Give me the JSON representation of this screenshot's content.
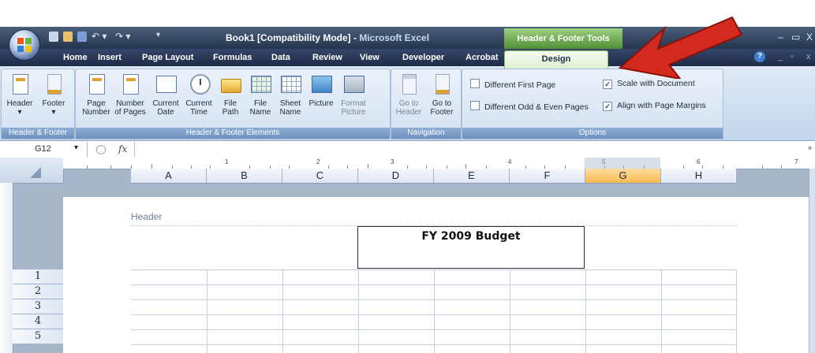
{
  "window": {
    "title_main": "Book1  [Compatibility Mode] - ",
    "title_app": "Microsoft Excel",
    "contextual_title": "Header & Footer Tools"
  },
  "tabs": [
    "Home",
    "Insert",
    "Page Layout",
    "Formulas",
    "Data",
    "Review",
    "View",
    "Developer",
    "Acrobat"
  ],
  "active_tab": "Design",
  "ribbon": {
    "groups": {
      "header_footer": {
        "label": "Header & Footer",
        "buttons": [
          {
            "line1": "Header",
            "line2": "▾"
          },
          {
            "line1": "Footer",
            "line2": "▾"
          }
        ]
      },
      "elements": {
        "label": "Header & Footer Elements",
        "buttons": [
          {
            "line1": "Page",
            "line2": "Number"
          },
          {
            "line1": "Number",
            "line2": "of Pages"
          },
          {
            "line1": "Current",
            "line2": "Date"
          },
          {
            "line1": "Current",
            "line2": "Time"
          },
          {
            "line1": "File",
            "line2": "Path"
          },
          {
            "line1": "File",
            "line2": "Name"
          },
          {
            "line1": "Sheet",
            "line2": "Name"
          },
          {
            "line1": "Picture",
            "line2": ""
          },
          {
            "line1": "Format",
            "line2": "Picture"
          }
        ]
      },
      "navigation": {
        "label": "Navigation",
        "buttons": [
          {
            "line1": "Go to",
            "line2": "Header"
          },
          {
            "line1": "Go to",
            "line2": "Footer"
          }
        ]
      },
      "options": {
        "label": "Options",
        "checks": [
          {
            "text": "Different First Page",
            "checked": false
          },
          {
            "text": "Different Odd & Even Pages",
            "checked": false
          },
          {
            "text": "Scale with Document",
            "checked": true
          },
          {
            "text": "Align with Page Margins",
            "checked": true
          }
        ]
      }
    }
  },
  "formula_bar": {
    "name_box": "G12",
    "fx": "fx",
    "value": ""
  },
  "ruler_numbers": [
    "1",
    "2",
    "3",
    "4",
    "5",
    "6",
    "7"
  ],
  "columns": [
    "A",
    "B",
    "C",
    "D",
    "E",
    "F",
    "G",
    "H"
  ],
  "selected_column": "G",
  "rows": [
    "1",
    "2",
    "3",
    "4",
    "5"
  ],
  "page": {
    "header_label": "Header",
    "center_header": "FY 2009  Budget"
  },
  "colors": {
    "title_bar": "#2f3f5c",
    "contextual_green": "#6aa84f",
    "arrow_red": "#d22a1e",
    "selected_header": "#f5b94f"
  }
}
